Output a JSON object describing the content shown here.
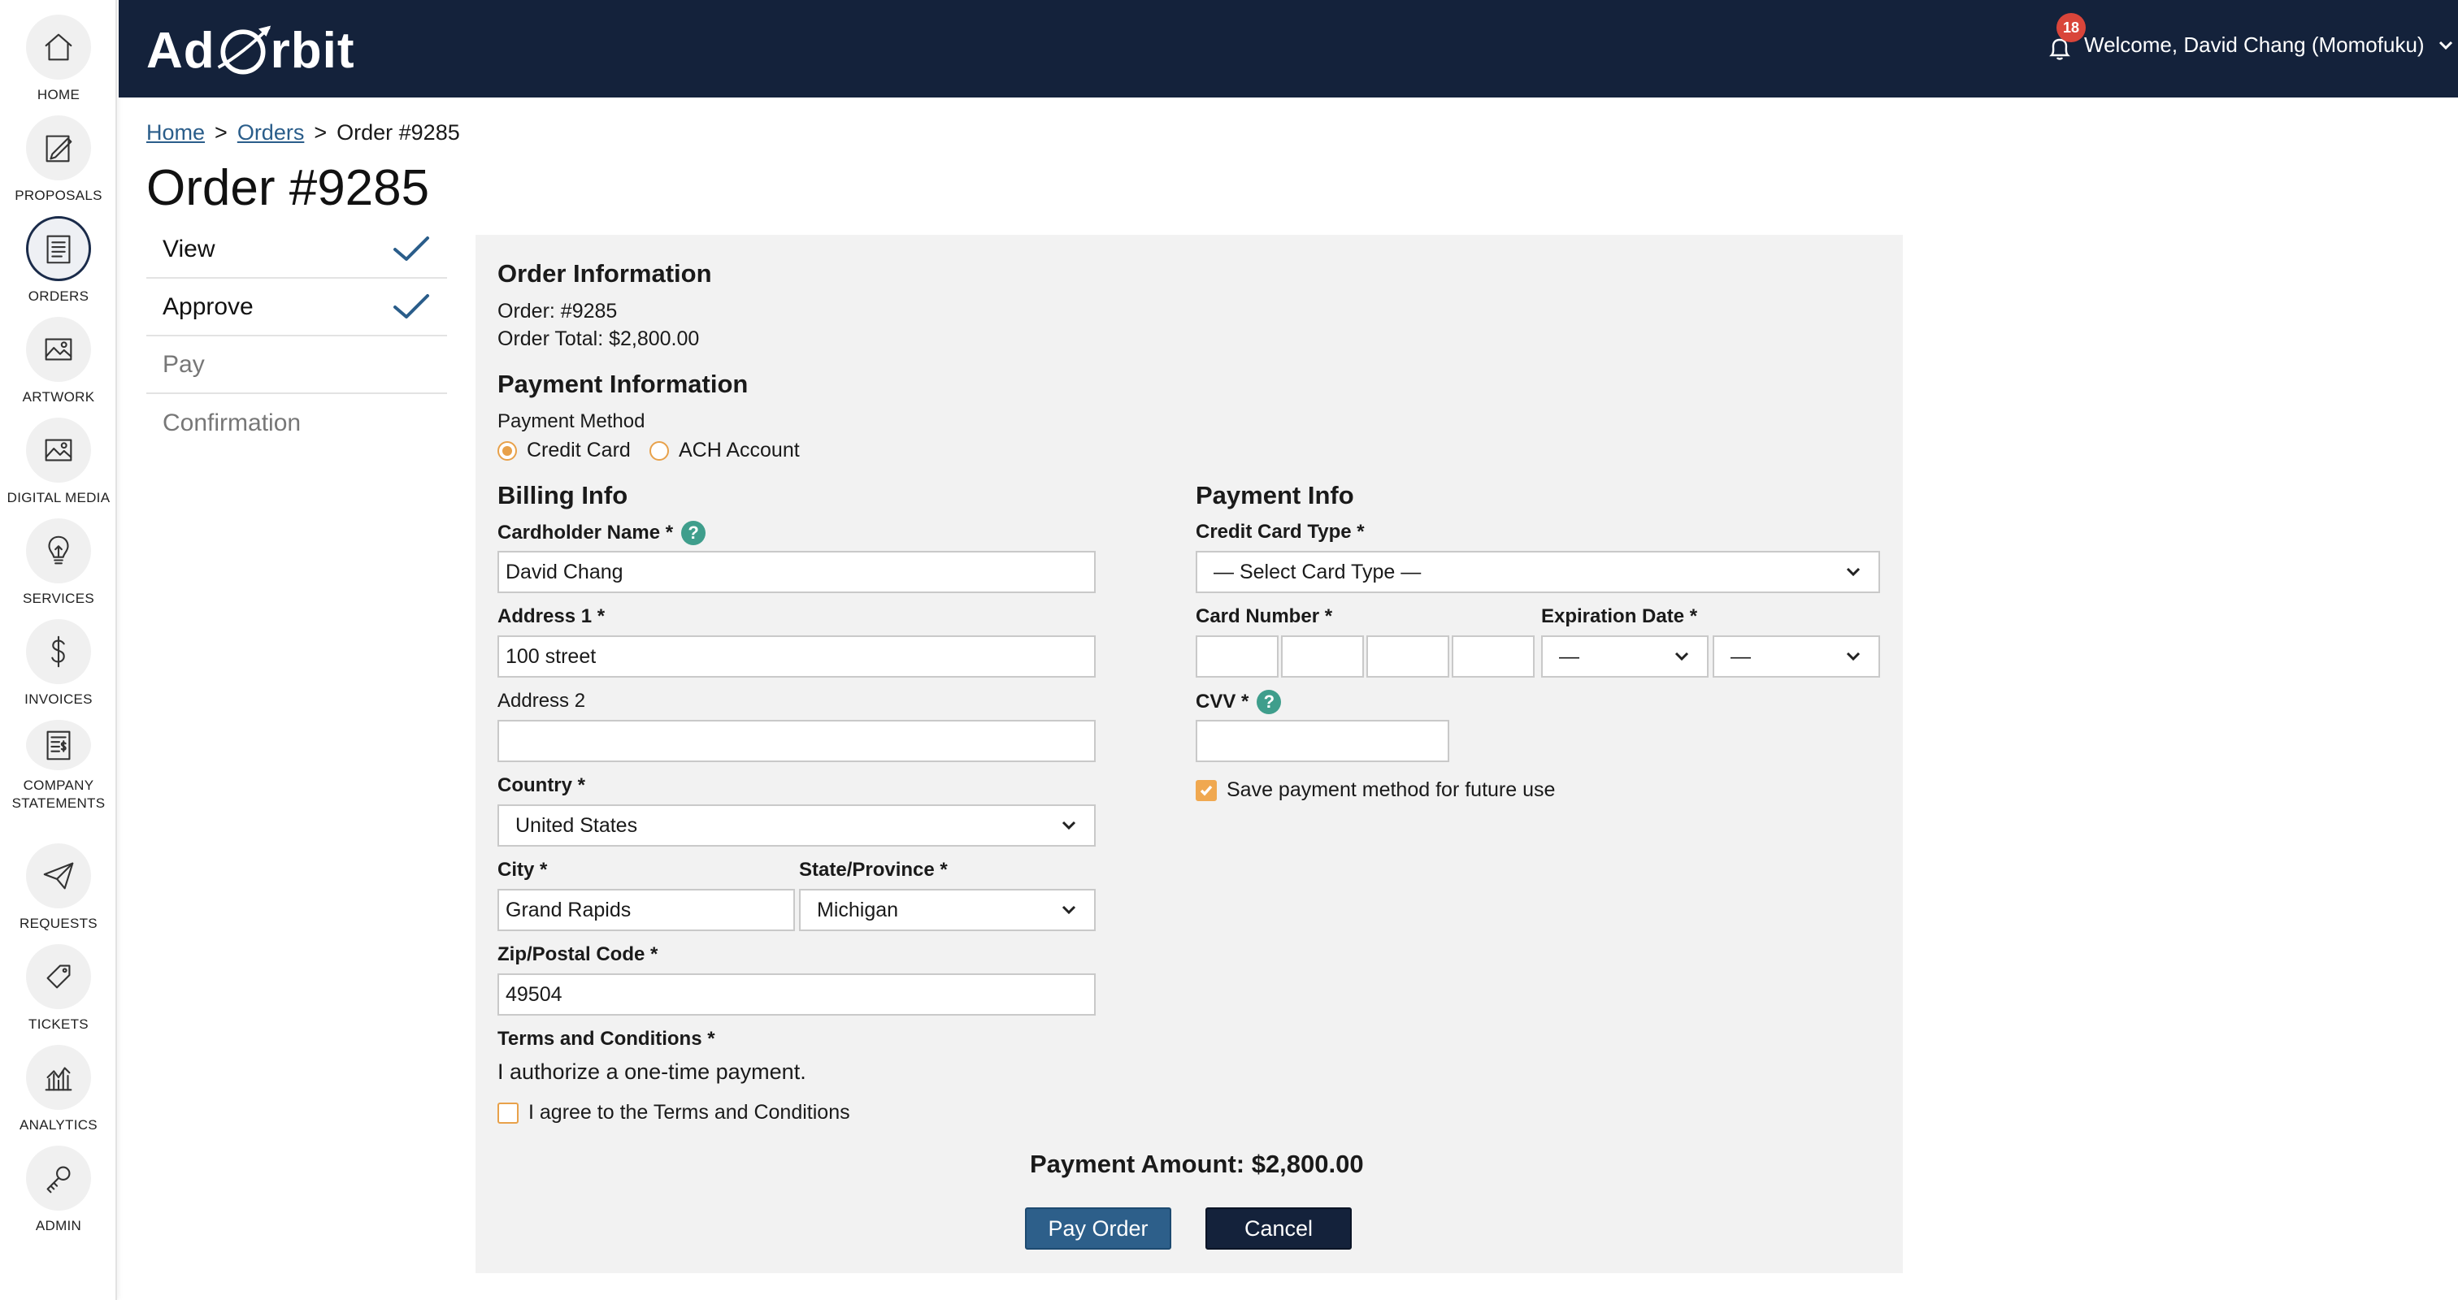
{
  "sidebar": {
    "items": [
      {
        "label": "HOME",
        "icon": "home-icon"
      },
      {
        "label": "PROPOSALS",
        "icon": "proposals-icon"
      },
      {
        "label": "ORDERS",
        "icon": "orders-icon",
        "active": true
      },
      {
        "label": "ARTWORK",
        "icon": "artwork-icon"
      },
      {
        "label": "DIGITAL MEDIA",
        "icon": "digital-media-icon"
      },
      {
        "label": "SERVICES",
        "icon": "services-icon"
      },
      {
        "label": "INVOICES",
        "icon": "invoices-icon"
      },
      {
        "label": "COMPANY STATEMENTS",
        "icon": "company-statements-icon"
      },
      {
        "label": "REQUESTS",
        "icon": "requests-icon"
      },
      {
        "label": "TICKETS",
        "icon": "tickets-icon"
      },
      {
        "label": "ANALYTICS",
        "icon": "analytics-icon"
      },
      {
        "label": "ADMIN",
        "icon": "admin-icon"
      }
    ]
  },
  "header": {
    "logo_left": "Ad",
    "logo_right": "rbit",
    "notification_count": "18",
    "welcome": "Welcome, David Chang (Momofuku)",
    "colors": {
      "bar": "#14223b",
      "badge": "#d9453a"
    }
  },
  "breadcrumb": {
    "home": "Home",
    "orders": "Orders",
    "current": "Order #9285",
    "sep": ">"
  },
  "page_title": "Order #9285",
  "steps": [
    {
      "label": "View",
      "done": true
    },
    {
      "label": "Approve",
      "done": true
    },
    {
      "label": "Pay",
      "done": false
    },
    {
      "label": "Confirmation",
      "done": false
    }
  ],
  "order_info": {
    "heading": "Order Information",
    "order_line": "Order: #9285",
    "total_line": "Order Total: $2,800.00"
  },
  "payment_info": {
    "heading": "Payment Information",
    "method_label": "Payment Method",
    "method_options": [
      "Credit Card",
      "ACH Account"
    ],
    "selected_method": "Credit Card"
  },
  "billing": {
    "heading": "Billing Info",
    "cardholder_label": "Cardholder Name *",
    "cardholder_value": "David Chang",
    "address1_label": "Address 1 *",
    "address1_value": "100 street",
    "address2_label": "Address 2",
    "address2_value": "",
    "country_label": "Country *",
    "country_value": "United States",
    "city_label": "City *",
    "city_value": "Grand Rapids",
    "state_label": "State/Province *",
    "state_value": "Michigan",
    "zip_label": "Zip/Postal Code *",
    "zip_value": "49504",
    "terms_label": "Terms and Conditions *",
    "terms_text": "I authorize a one-time payment.",
    "agree_label": "I agree to the Terms and Conditions",
    "agree_checked": false
  },
  "card": {
    "heading": "Payment Info",
    "type_label": "Credit Card Type *",
    "type_value": "— Select Card Type —",
    "number_label": "Card Number *",
    "expiration_label": "Expiration Date *",
    "exp_month_value": "—",
    "exp_year_value": "—",
    "cvv_label": "CVV *",
    "save_label": "Save payment method for future use",
    "save_checked": true
  },
  "payment_amount": "Payment Amount: $2,800.00",
  "actions": {
    "pay": "Pay Order",
    "cancel": "Cancel"
  },
  "theme": {
    "accent": "#e8a14a",
    "link": "#2a5d8a",
    "help": "#3f9e8c",
    "panel": "#f2f2f2"
  }
}
